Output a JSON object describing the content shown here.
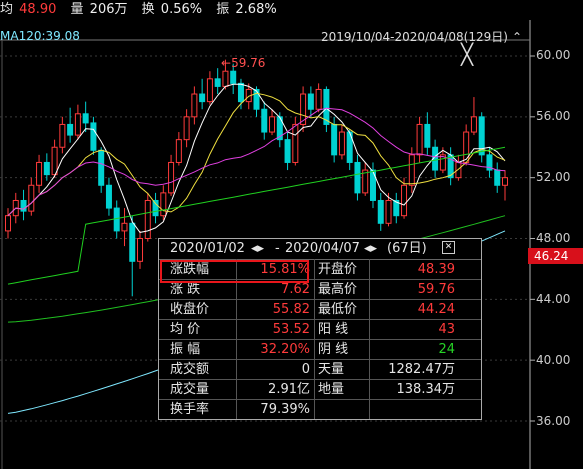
{
  "topbar": {
    "avg_label": "均",
    "avg_value": "48.90",
    "vol_label": "量",
    "vol_value": "206万",
    "turnover_label": "换",
    "turnover_value": "0.56%",
    "amp_label": "振",
    "amp_value": "2.68%"
  },
  "indicator": {
    "ma120": "MA120:39.08"
  },
  "date_range": "2019/10/04-2020/04/08(129日)",
  "peak_annotation": "59.76",
  "current_price": "46.24",
  "y_ticks": [
    "60.00",
    "56.00",
    "52.00",
    "48.00",
    "44.00",
    "40.00",
    "36.00"
  ],
  "panel": {
    "start": "2020/01/02",
    "end": "2020/04/07",
    "days": "(67日)",
    "rows": [
      {
        "k1": "涨跌幅",
        "v1": "15.81%",
        "c1": "red",
        "k2": "开盘价",
        "v2": "48.39",
        "c2": "red"
      },
      {
        "k1": "涨  跌",
        "v1": "7.62",
        "c1": "red",
        "k2": "最高价",
        "v2": "59.76",
        "c2": "red"
      },
      {
        "k1": "收盘价",
        "v1": "55.82",
        "c1": "red",
        "k2": "最低价",
        "v2": "44.24",
        "c2": "red"
      },
      {
        "k1": "均  价",
        "v1": "53.52",
        "c1": "red",
        "k2": "阳  线",
        "v2": "43",
        "c2": "red"
      },
      {
        "k1": "振  幅",
        "v1": "32.20%",
        "c1": "red",
        "k2": "阴  线",
        "v2": "24",
        "c2": "green"
      },
      {
        "k1": "成交额",
        "v1": "0",
        "c1": "white",
        "k2": "天量",
        "v2": "1282.47万",
        "c2": "white"
      },
      {
        "k1": "成交量",
        "v1": "2.91亿",
        "c1": "white",
        "k2": "地量",
        "v2": "138.34万",
        "c2": "white"
      },
      {
        "k1": "换手率",
        "v1": "79.39%",
        "c1": "white",
        "k2": "",
        "v2": "",
        "c2": "white"
      }
    ]
  },
  "chart_data": {
    "type": "candlestick",
    "ylim": [
      35,
      61.5
    ],
    "y_ticks": [
      60,
      56,
      52,
      48,
      44,
      40,
      36
    ],
    "grid": true,
    "candles": [
      [
        48.5,
        49.5,
        48.0,
        50.0
      ],
      [
        49.5,
        50.5,
        49.0,
        51.0
      ],
      [
        50.5,
        49.8,
        49.2,
        51.2
      ],
      [
        49.8,
        51.5,
        49.5,
        52.0
      ],
      [
        51.5,
        53.0,
        51.0,
        53.5
      ],
      [
        53.0,
        52.2,
        51.8,
        53.6
      ],
      [
        52.2,
        54.0,
        52.0,
        54.5
      ],
      [
        54.0,
        55.5,
        53.6,
        56.0
      ],
      [
        55.5,
        54.8,
        54.3,
        56.6
      ],
      [
        54.8,
        56.2,
        54.5,
        56.8
      ],
      [
        56.2,
        55.6,
        55.0,
        57.0
      ],
      [
        55.6,
        53.8,
        53.5,
        56.0
      ],
      [
        53.8,
        51.5,
        51.0,
        54.0
      ],
      [
        51.5,
        50.0,
        49.5,
        52.0
      ],
      [
        50.0,
        48.5,
        48.0,
        50.5
      ],
      [
        48.5,
        49.0,
        47.5,
        50.0
      ],
      [
        49.0,
        46.5,
        44.2,
        49.5
      ],
      [
        46.5,
        48.0,
        46.0,
        48.5
      ],
      [
        48.0,
        50.5,
        47.8,
        51.0
      ],
      [
        50.5,
        49.5,
        49.0,
        51.0
      ],
      [
        49.5,
        51.0,
        49.2,
        51.5
      ],
      [
        51.0,
        53.0,
        50.8,
        53.5
      ],
      [
        53.0,
        54.5,
        52.8,
        55.0
      ],
      [
        54.5,
        56.0,
        54.0,
        56.5
      ],
      [
        56.0,
        57.5,
        55.5,
        58.0
      ],
      [
        57.5,
        57.0,
        56.5,
        58.5
      ],
      [
        57.0,
        58.5,
        56.8,
        59.0
      ],
      [
        58.5,
        58.0,
        57.5,
        59.2
      ],
      [
        58.0,
        59.0,
        57.8,
        59.76
      ],
      [
        59.0,
        58.2,
        57.5,
        59.5
      ],
      [
        58.2,
        57.0,
        56.5,
        58.5
      ],
      [
        57.0,
        57.8,
        56.5,
        58.2
      ],
      [
        57.8,
        56.5,
        56.0,
        58.0
      ],
      [
        56.5,
        55.0,
        54.5,
        57.0
      ],
      [
        55.0,
        56.0,
        54.8,
        56.5
      ],
      [
        56.0,
        54.5,
        54.0,
        56.3
      ],
      [
        54.5,
        53.0,
        52.5,
        55.0
      ],
      [
        53.0,
        55.5,
        52.8,
        56.0
      ],
      [
        55.5,
        57.5,
        55.0,
        58.0
      ],
      [
        57.5,
        56.5,
        56.0,
        58.0
      ],
      [
        56.5,
        57.8,
        56.3,
        58.2
      ],
      [
        57.8,
        55.5,
        55.0,
        58.0
      ],
      [
        55.5,
        53.5,
        53.0,
        56.0
      ],
      [
        53.5,
        55.0,
        53.2,
        55.5
      ],
      [
        55.0,
        53.0,
        52.5,
        55.2
      ],
      [
        53.0,
        51.0,
        50.5,
        53.5
      ],
      [
        51.0,
        52.5,
        50.8,
        53.0
      ],
      [
        52.5,
        50.5,
        50.0,
        53.0
      ],
      [
        50.5,
        49.0,
        48.5,
        51.0
      ],
      [
        49.0,
        50.5,
        48.8,
        51.0
      ],
      [
        50.5,
        49.5,
        49.0,
        51.0
      ],
      [
        49.5,
        51.5,
        49.3,
        52.0
      ],
      [
        51.5,
        53.5,
        51.0,
        54.0
      ],
      [
        53.5,
        55.5,
        53.0,
        56.0
      ],
      [
        55.5,
        54.0,
        53.5,
        56.3
      ],
      [
        54.0,
        52.5,
        52.0,
        54.5
      ],
      [
        52.5,
        53.5,
        52.3,
        54.0
      ],
      [
        53.5,
        52.0,
        51.5,
        54.0
      ],
      [
        52.0,
        53.0,
        51.8,
        53.5
      ],
      [
        53.0,
        55.0,
        52.8,
        55.5
      ],
      [
        55.0,
        56.0,
        54.8,
        57.3
      ],
      [
        56.0,
        53.5,
        53.0,
        56.3
      ],
      [
        53.5,
        52.5,
        52.0,
        54.0
      ],
      [
        52.5,
        51.5,
        51.0,
        53.0
      ],
      [
        51.5,
        52.0,
        50.5,
        52.5
      ]
    ]
  },
  "colors": {
    "up": "#ff3b3b",
    "down": "#00d2d2",
    "ma5": "#ffffff",
    "ma10": "#f0e040",
    "ma20": "#e040e0",
    "ma60": "#20d020",
    "ma120": "#7fe8ff"
  }
}
